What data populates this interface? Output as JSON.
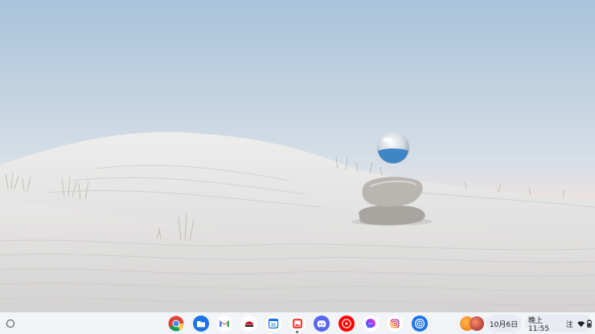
{
  "wallpaper": {
    "sky_top": "#a9c4dc",
    "sky_bottom": "#efe3dc",
    "sand": "#e4e2e0"
  },
  "shelf": {
    "apps": [
      {
        "name": "Chrome",
        "icon": "chrome-icon"
      },
      {
        "name": "Files",
        "icon": "files-icon"
      },
      {
        "name": "Gmail",
        "icon": "gmail-icon"
      },
      {
        "name": "Pizza Hut",
        "icon": "pizza-hut-icon"
      },
      {
        "name": "Calendar",
        "icon": "calendar-icon"
      },
      {
        "name": "Gallery",
        "icon": "gallery-icon"
      },
      {
        "name": "Discord",
        "icon": "discord-icon"
      },
      {
        "name": "YouTube Music",
        "icon": "youtube-music-icon"
      },
      {
        "name": "Messenger",
        "icon": "messenger-icon"
      },
      {
        "name": "Instagram",
        "icon": "instagram-icon"
      },
      {
        "name": "Nearby Share",
        "icon": "nearby-share-icon"
      }
    ],
    "calendar_day": "31"
  },
  "tray": {
    "date": "10月6日",
    "time": "晚上11:55",
    "ime": "注"
  }
}
